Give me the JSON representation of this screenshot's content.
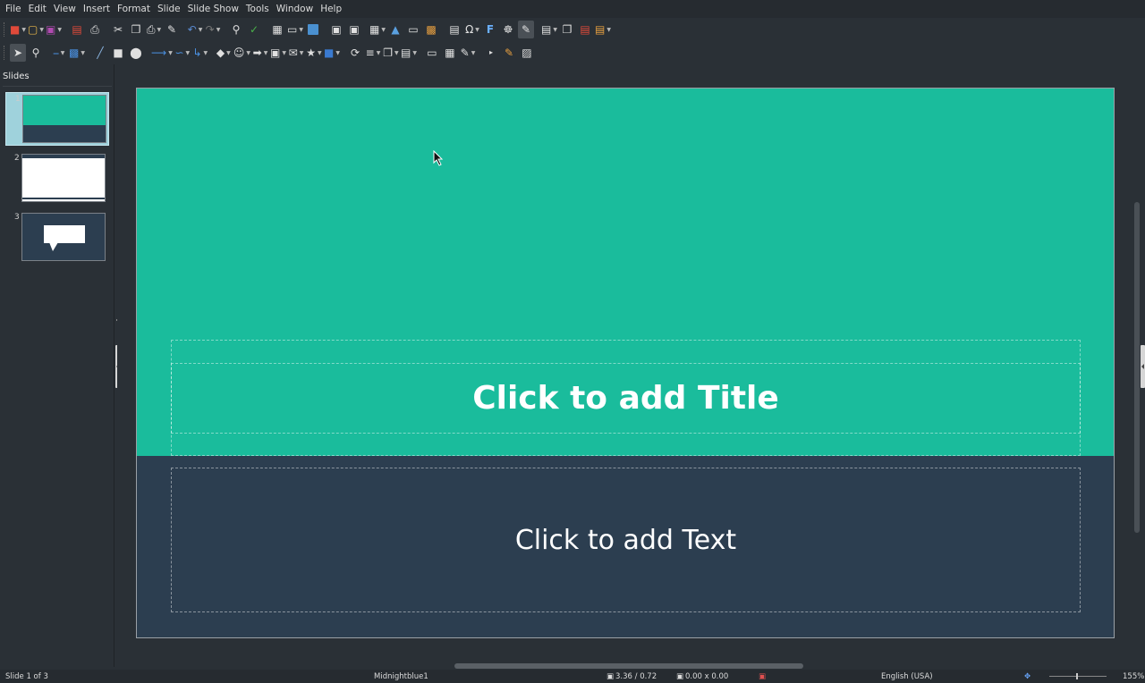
{
  "menubar": {
    "items": [
      "File",
      "Edit",
      "View",
      "Insert",
      "Format",
      "Slide",
      "Slide Show",
      "Tools",
      "Window",
      "Help"
    ]
  },
  "toolbar1": {
    "icons": [
      "new-icon",
      "open-icon",
      "save-icon",
      "export-pdf-icon",
      "print-icon",
      "cut-icon",
      "copy-icon",
      "paste-icon",
      "clone-formatting-icon",
      "undo-icon",
      "redo-icon",
      "find-icon",
      "spelling-icon",
      "grid-icon",
      "display-views-icon",
      "master-slide-icon",
      "new-slide-icon",
      "duplicate-slide-icon",
      "table-icon",
      "image-icon",
      "media-icon",
      "chart-icon",
      "textbox-icon",
      "special-character-icon",
      "fontwork-icon",
      "hyperlink-icon",
      "draw-functions-icon",
      "slide-layout-icon",
      "slide-transition-icon",
      "hide-slide-icon",
      "display-options-icon"
    ]
  },
  "toolbar2": {
    "icons": [
      "select-icon",
      "zoom-pan-icon",
      "line-color-icon",
      "fill-color-icon",
      "line-icon",
      "rectangle-icon",
      "ellipse-icon",
      "line-arrow-icon",
      "curve-icon",
      "connector-icon",
      "basic-shapes-icon",
      "symbol-shapes-icon",
      "block-arrows-icon",
      "flowchart-icon",
      "callouts-icon",
      "stars-icon",
      "3d-objects-icon",
      "transformations-icon",
      "align-icon",
      "arrange-icon",
      "distribute-icon",
      "shadow-icon",
      "crop-icon",
      "filter-icon",
      "points-icon",
      "glue-points-icon",
      "toggle-extrusion-icon"
    ]
  },
  "slides_pane": {
    "header": "Slides",
    "thumbs": [
      {
        "number": "1",
        "selected": true
      },
      {
        "number": "2",
        "selected": false
      },
      {
        "number": "3",
        "selected": false
      }
    ]
  },
  "slide": {
    "title_placeholder": "Click to add Title",
    "text_placeholder": "Click to add Text",
    "colors": {
      "top": "#1abc9c",
      "bottom": "#2c3e50"
    }
  },
  "statusbar": {
    "slide_info": "Slide 1 of 3",
    "master": "Midnightblue1",
    "position": "3.36 / 0.72",
    "size": "0.00 x 0.00",
    "language": "English (USA)",
    "zoom": "155%"
  }
}
